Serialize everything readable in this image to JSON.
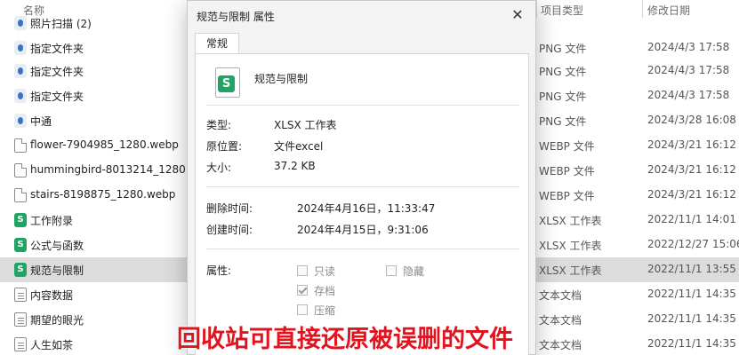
{
  "header": {
    "name_col": "名称",
    "type_col": "项目类型",
    "date_col": "修改日期"
  },
  "files": [
    {
      "name": "照片扫描 (2)",
      "type": "",
      "date": "",
      "icon": "shortcut-icon"
    },
    {
      "name": "指定文件夹",
      "type": "PNG 文件",
      "date": "2024/4/3 17:58",
      "icon": "shortcut-icon"
    },
    {
      "name": "指定文件夹",
      "type": "PNG 文件",
      "date": "2024/4/3 17:58",
      "icon": "shortcut-icon"
    },
    {
      "name": "指定文件夹",
      "type": "PNG 文件",
      "date": "2024/4/3 17:58",
      "icon": "shortcut-icon"
    },
    {
      "name": "中通",
      "type": "PNG 文件",
      "date": "2024/3/28 16:08",
      "icon": "shortcut-icon"
    },
    {
      "name": "flower-7904985_1280.webp",
      "type": "WEBP 文件",
      "date": "2024/3/21 16:12",
      "icon": "file-icon"
    },
    {
      "name": "hummingbird-8013214_1280.webp",
      "type": "WEBP 文件",
      "date": "2024/3/21 16:12",
      "icon": "file-icon"
    },
    {
      "name": "stairs-8198875_1280.webp",
      "type": "WEBP 文件",
      "date": "2024/3/21 16:12",
      "icon": "file-icon"
    },
    {
      "name": "工作附录",
      "type": "XLSX 工作表",
      "date": "2022/11/1 14:01",
      "icon": "spreadsheet-icon"
    },
    {
      "name": "公式与函数",
      "type": "XLSX 工作表",
      "date": "2022/12/27 15:06",
      "icon": "spreadsheet-icon"
    },
    {
      "name": "规范与限制",
      "type": "XLSX 工作表",
      "date": "2022/11/1 13:55",
      "icon": "spreadsheet-icon"
    },
    {
      "name": "内容数据",
      "type": "文本文档",
      "date": "2022/11/1 14:35",
      "icon": "text-file-icon"
    },
    {
      "name": "期望的眼光",
      "type": "文本文档",
      "date": "2022/11/1 14:35",
      "icon": "text-file-icon"
    },
    {
      "name": "人生如茶",
      "type": "文本文档",
      "date": "2022/11/1 14:35",
      "icon": "text-file-icon"
    }
  ],
  "dialog": {
    "title": "规范与限制 属性",
    "close": "✕",
    "tab": "常规",
    "file_name": "规范与限制",
    "file_badge": "S",
    "type_label": "类型:",
    "type_value": "XLSX 工作表",
    "location_label": "原位置:",
    "location_value": "文件excel",
    "size_label": "大小:",
    "size_value": "37.2 KB",
    "deleted_label": "删除时间:",
    "deleted_value": "2024年4月16日，11:33:47",
    "created_label": "创建时间:",
    "created_value": "2024年4月15日，9:31:06",
    "attributes_label": "属性:",
    "readonly_label": "只读",
    "hidden_label": "隐藏",
    "archive_label": "存档",
    "compress_label": "压缩"
  },
  "caption": "回收站可直接还原被误删的文件",
  "colors": {
    "accent_green": "#21a366",
    "caption_red": "#e0141e"
  }
}
